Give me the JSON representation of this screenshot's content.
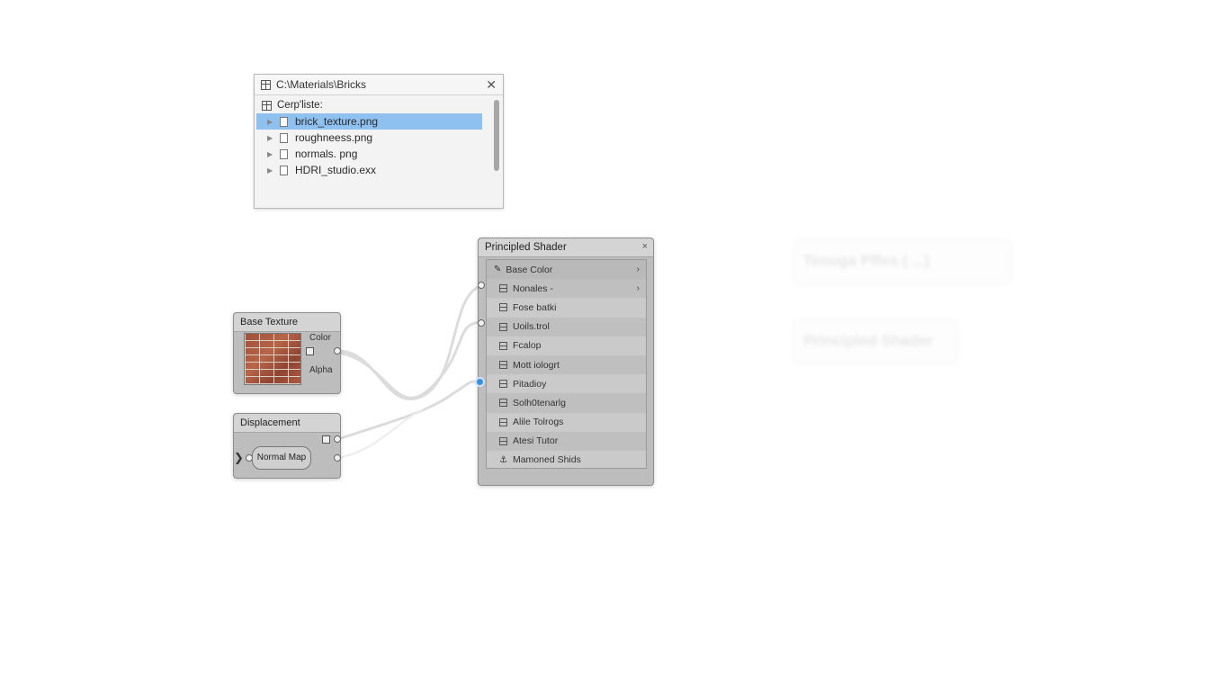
{
  "file_browser": {
    "path": "C:\\Materials\\Bricks",
    "header": "Cerp'liste:",
    "files": [
      {
        "name": "brick_texture.png"
      },
      {
        "name": "roughneess.png"
      },
      {
        "name": "normals. png"
      },
      {
        "name": "HDRI_studio.exx"
      }
    ],
    "selected_index": 0
  },
  "nodes": {
    "base_texture": {
      "title": "Base Texture",
      "output_color": "Color",
      "output_alpha": "Alpha"
    },
    "displacement": {
      "title": "Displacement",
      "input": "Normal Map"
    },
    "shader": {
      "title": "Principled Shader",
      "close": "×",
      "inputs": [
        {
          "label": "Base Color"
        },
        {
          "label": "Nonales -"
        },
        {
          "label": "Fose batki"
        },
        {
          "label": "Uoils.trol"
        },
        {
          "label": "Fcalop"
        },
        {
          "label": "Mott iologrt"
        },
        {
          "label": "Pitadioy"
        },
        {
          "label": "Solh0tenarlg"
        },
        {
          "label": "Alile Tolrogs"
        },
        {
          "label": "Atesi Tutor"
        },
        {
          "label": "Mamoned Shids"
        }
      ]
    }
  },
  "ghost_panels": [
    {
      "text": "Tenuga Pffes ( ...)"
    },
    {
      "text": "Principled Shader"
    }
  ],
  "colors": {
    "selection": "#8ec0f0",
    "active_socket": "#3b8ee0",
    "node_body": "#bdbdbd"
  }
}
